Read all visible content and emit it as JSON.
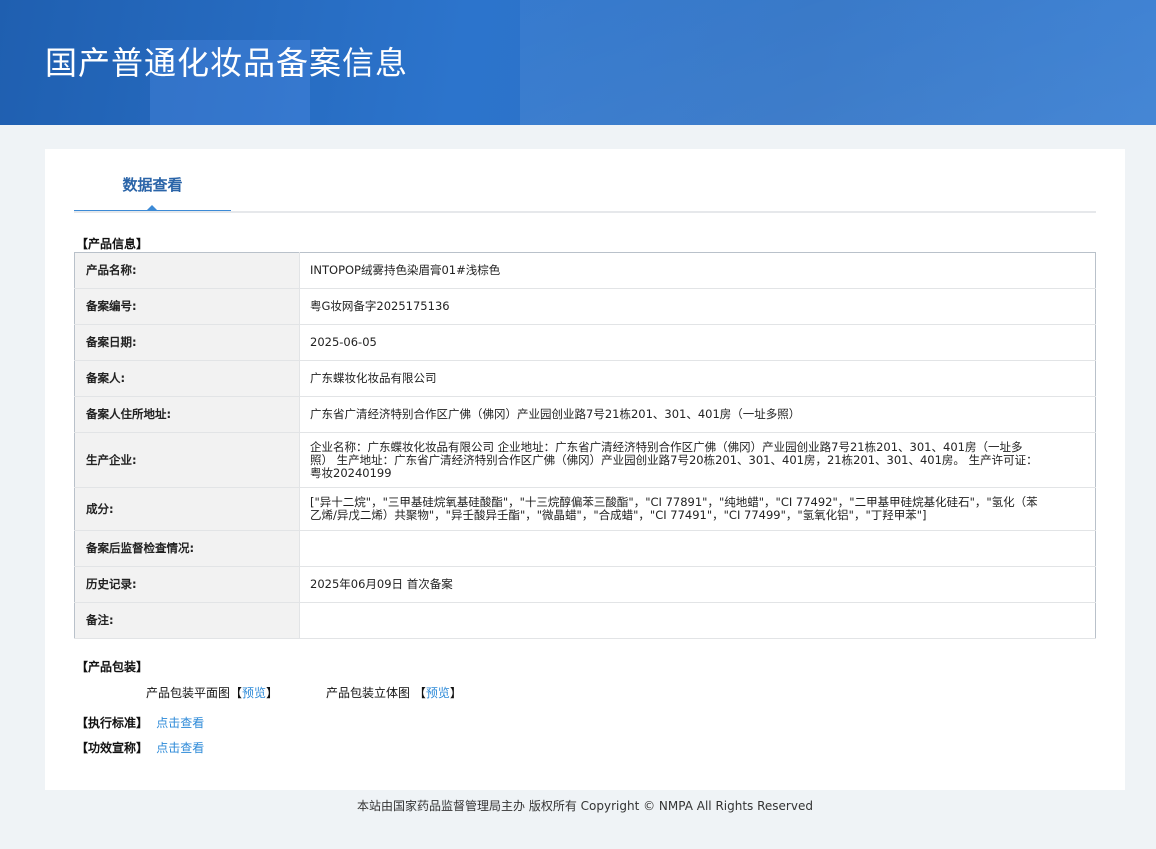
{
  "header": {
    "title": "国产普通化妆品备案信息"
  },
  "tab": {
    "label": "数据查看"
  },
  "product_info": {
    "title": "【产品信息】",
    "rows": [
      {
        "label": "产品名称:",
        "value": "INTOPOP绒雾持色染眉膏01#浅棕色"
      },
      {
        "label": "备案编号:",
        "value": "粤G妆网备字2025175136"
      },
      {
        "label": "备案日期:",
        "value": "2025-06-05"
      },
      {
        "label": "备案人:",
        "value": "广东蝶妆化妆品有限公司"
      },
      {
        "label": "备案人住所地址:",
        "value": "广东省广清经济特别合作区广佛（佛冈）产业园创业路7号21栋201、301、401房（一址多照）"
      },
      {
        "label": "生产企业:",
        "value": "企业名称：广东蝶妆化妆品有限公司 企业地址：广东省广清经济特别合作区广佛（佛冈）产业园创业路7号21栋201、301、401房（一址多照） 生产地址：广东省广清经济特别合作区广佛（佛冈）产业园创业路7号20栋201、301、401房，21栋201、301、401房。 生产许可证：粤妆20240199"
      },
      {
        "label": "成分:",
        "value": "[\"异十二烷\"，\"三甲基硅烷氧基硅酸酯\"，\"十三烷醇偏苯三酸酯\"，\"CI 77891\"，\"纯地蜡\"，\"CI 77492\"，\"二甲基甲硅烷基化硅石\"，\"氢化（苯乙烯/异戊二烯）共聚物\"，\"异壬酸异壬酯\"，\"微晶蜡\"，\"合成蜡\"，\"CI 77491\"，\"CI 77499\"，\"氢氧化铝\"，\"丁羟甲苯\"]"
      },
      {
        "label": "备案后监督检查情况:",
        "value": ""
      },
      {
        "label": "历史记录:",
        "value": "2025年06月09日 首次备案"
      },
      {
        "label": "备注:",
        "value": ""
      }
    ]
  },
  "packaging": {
    "title": "【产品包装】",
    "flat_label": "产品包装平面图",
    "solid_label": "产品包装立体图",
    "preview": "预览",
    "bracket_open": "【",
    "bracket_close": "】"
  },
  "standard": {
    "title": "【执行标准】",
    "link": "点击查看"
  },
  "efficacy": {
    "title": "【功效宣称】",
    "link": "点击查看"
  },
  "footer": {
    "text": "本站由国家药品监督管理局主办 版权所有 Copyright © NMPA All Rights Reserved"
  }
}
